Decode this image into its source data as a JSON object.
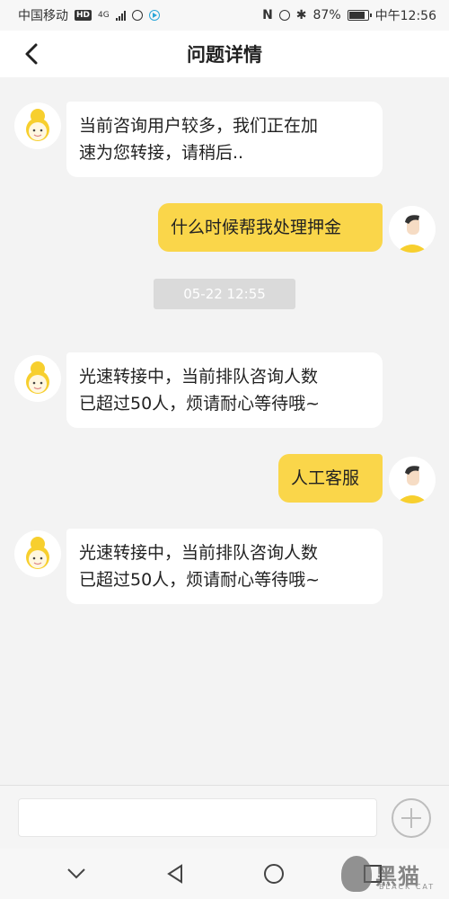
{
  "status_bar": {
    "carrier": "中国移动",
    "hd_badge": "HD",
    "net_type": "4G",
    "battery": "87%",
    "time": "中午12:56",
    "battery_level": 0.87
  },
  "header": {
    "title": "问题详情"
  },
  "messages": [
    {
      "side": "left",
      "text_lines": [
        "当前咨询用户较多，我们正在加",
        "速为您转接，请稍后.."
      ]
    },
    {
      "side": "right",
      "text_lines": [
        "什么时候帮我处理押金"
      ]
    },
    {
      "side": "timestamp",
      "text": "05-22 12:55"
    },
    {
      "side": "left",
      "text_lines": [
        "光速转接中，当前排队咨询人数",
        "已超过50人，烦请耐心等待哦~"
      ]
    },
    {
      "side": "right",
      "text_lines": [
        "人工客服"
      ]
    },
    {
      "side": "left",
      "text_lines": [
        "光速转接中，当前排队咨询人数",
        "已超过50人，烦请耐心等待哦~"
      ]
    }
  ],
  "input": {
    "value": "",
    "placeholder": ""
  },
  "watermark": {
    "text": "黑猫",
    "sub": "BLACK CAT"
  },
  "colors": {
    "accent": "#fad64a",
    "background": "#f3f3f3",
    "bubble_left": "#ffffff"
  },
  "icons": [
    "back-arrow-icon",
    "plus-icon",
    "nav-down-icon",
    "nav-back-icon",
    "nav-home-icon",
    "nav-recent-icon"
  ]
}
